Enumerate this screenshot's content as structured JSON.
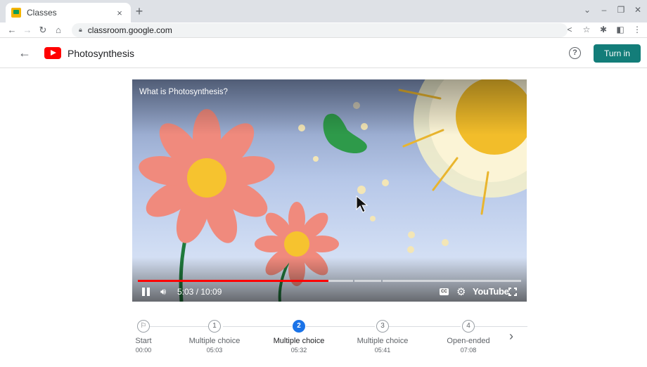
{
  "browser": {
    "tab_title": "Classes",
    "tab_close": "×",
    "new_tab": "+",
    "url": "classroom.google.com"
  },
  "header": {
    "title": "Photosynthesis",
    "turn_in_label": "Turn in",
    "help_glyph": "?"
  },
  "video": {
    "title": "What is Photosynthesis?",
    "current_time": "5:03",
    "duration": "10:09",
    "time_display": "5:03 / 10:09",
    "progress_fraction": 0.497,
    "brand": "YouTube",
    "cc_label": "CC"
  },
  "steps": [
    {
      "marker": "",
      "label": "Start",
      "time": "00:00",
      "active": false,
      "icon": "flag-icon"
    },
    {
      "marker": "1",
      "label": "Multiple choice",
      "time": "05:03",
      "active": false
    },
    {
      "marker": "2",
      "label": "Multiple choice",
      "time": "05:32",
      "active": true
    },
    {
      "marker": "3",
      "label": "Multiple choice",
      "time": "05:41",
      "active": false
    },
    {
      "marker": "4",
      "label": "Open-ended",
      "time": "07:08",
      "active": false
    }
  ],
  "colors": {
    "turn_in_bg": "#137d79",
    "active_step": "#1a73e8",
    "progress_played": "#ff0000"
  }
}
